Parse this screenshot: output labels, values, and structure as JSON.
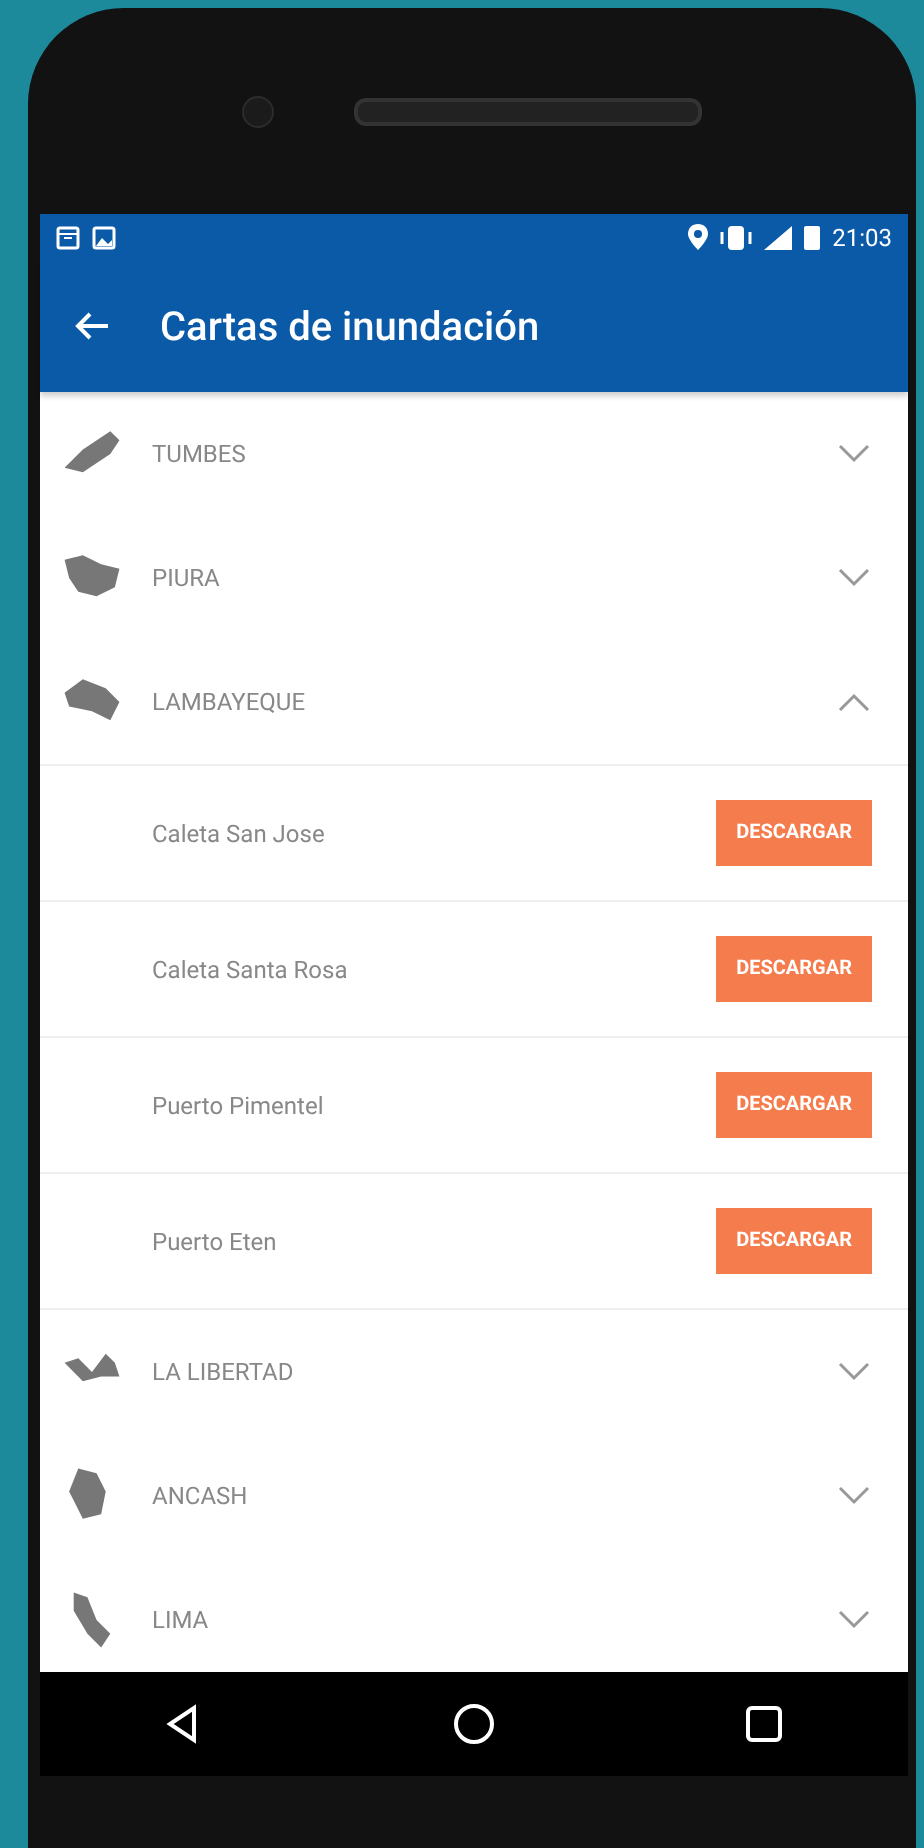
{
  "status_bar": {
    "time": "21:03"
  },
  "app_bar": {
    "title": "Cartas de inundación"
  },
  "regions": [
    {
      "name": "TUMBES",
      "expanded": false
    },
    {
      "name": "PIURA",
      "expanded": false
    },
    {
      "name": "LAMBAYEQUE",
      "expanded": true,
      "children": [
        {
          "name": "Caleta San Jose",
          "button": "DESCARGAR"
        },
        {
          "name": "Caleta Santa Rosa",
          "button": "DESCARGAR"
        },
        {
          "name": "Puerto Pimentel",
          "button": "DESCARGAR"
        },
        {
          "name": "Puerto Eten",
          "button": "DESCARGAR"
        }
      ]
    },
    {
      "name": "LA LIBERTAD",
      "expanded": false
    },
    {
      "name": "ANCASH",
      "expanded": false
    },
    {
      "name": "LIMA",
      "expanded": false
    }
  ]
}
